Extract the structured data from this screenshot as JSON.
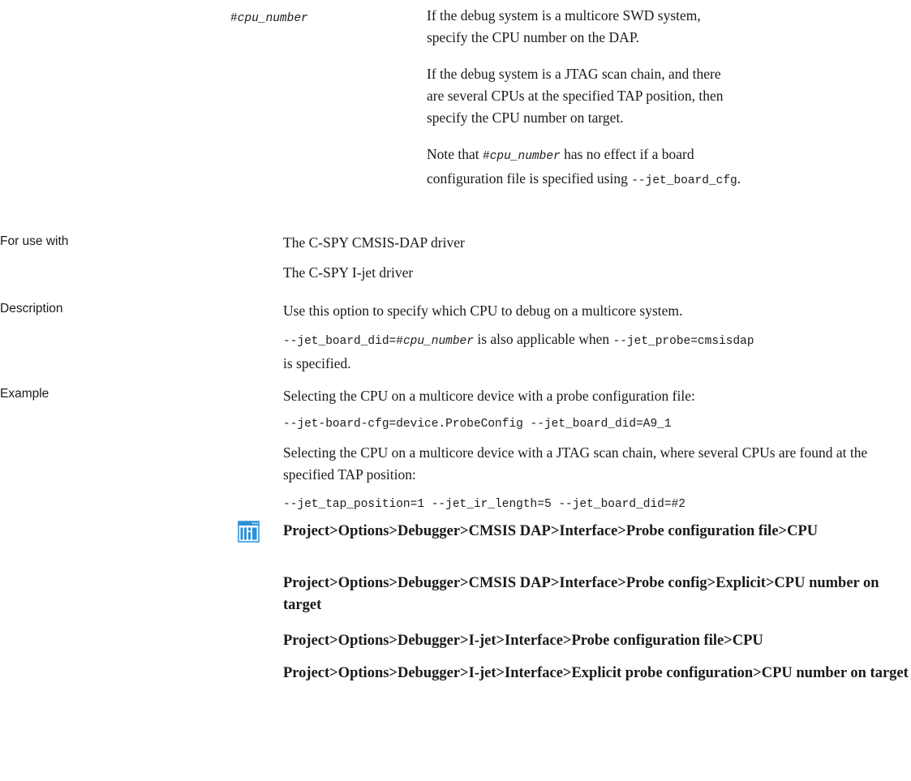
{
  "param": {
    "hash": "#",
    "name": "cpu_number",
    "desc1": "If the debug system is a multicore SWD system, specify the CPU number on the DAP.",
    "desc2": "If the debug system is a JTAG scan chain, and there are several CPUs at the specified TAP position, then specify the CPU number on target.",
    "note_prefix": "Note that ",
    "note_hash": "#",
    "note_name": "cpu_number",
    "note_mid": " has no effect if a board configuration file is specified using ",
    "note_code": "--jet_board_cfg",
    "note_end": "."
  },
  "for_use_with": {
    "label": "For use with",
    "item1": "The C-SPY CMSIS-DAP driver",
    "item2": "The C-SPY I-jet driver"
  },
  "description": {
    "label": "Description",
    "text1": "Use this option to specify which CPU to debug on a multicore system.",
    "code1": "--jet_board_did=#",
    "code1_italic": "cpu_number",
    "mid": " is also applicable when ",
    "code2": "--jet_probe=cmsisdap",
    "end": "is specified."
  },
  "example": {
    "label": "Example",
    "text1": "Selecting the CPU on a multicore device with a probe configuration file:",
    "code1": "--jet-board-cfg=device.ProbeConfig --jet_board_did=A9_1",
    "text2": "Selecting the CPU on a multicore device with a JTAG scan chain, where several CPUs are found at the specified TAP position:",
    "code2": "--jet_tap_position=1 --jet_ir_length=5 --jet_board_did=#2"
  },
  "ide": {
    "icon": "ide-options-icon",
    "path1": "Project>Options>Debugger>CMSIS DAP>Interface>Probe configuration file>CPU",
    "path2": "Project>Options>Debugger>CMSIS DAP>Interface>Probe config>Explicit>CPU number on target",
    "path3": "Project>Options>Debugger>I-jet>Interface>Probe configuration file>CPU",
    "path4": "Project>Options>Debugger>I-jet>Interface>Explicit probe configuration>CPU number on target"
  },
  "colors": {
    "icon_blue": "#2a8fd6",
    "text": "#1a1a1a"
  }
}
